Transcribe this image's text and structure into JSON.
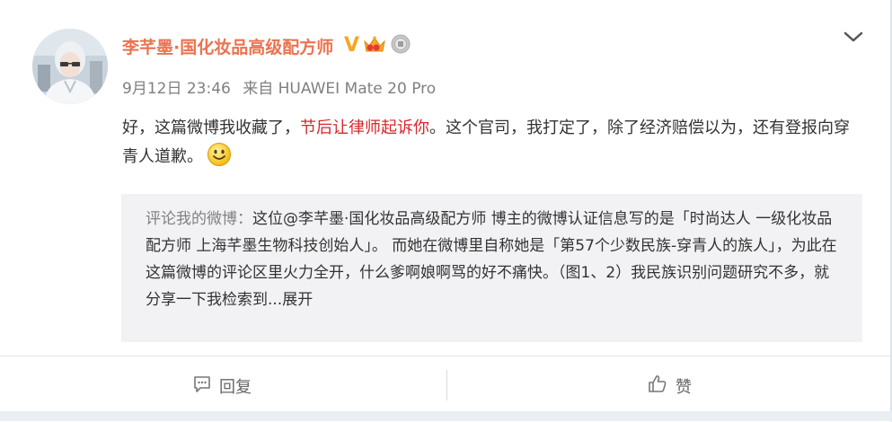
{
  "post": {
    "username": "李芊墨·国化妆品高级配方师",
    "badges": [
      "verified-v-icon",
      "vip-crown-icon",
      "medal-icon"
    ],
    "date": "9月12日 23:46",
    "source": "来自 HUAWEI Mate 20 Pro",
    "text_before": "好，这篇微博我收藏了，",
    "text_highlight": "节后让律师起诉你",
    "text_after": "。这个官司，我打定了，除了经济赔偿以为，还有登报向穿青人道歉。",
    "emoji": "smiley-icon"
  },
  "quote": {
    "source_label": "评论我的微博：",
    "text": "这位@李芊墨·国化妆品高级配方师  博主的微博认证信息写的是「时尚达人 一级化妆品配方师 上海芊墨生物科技创始人」。 而她在微博里自称她是「第57个少数民族-穿青人的族人」，为此在这篇微博的评论区里火力全开，什么爹啊娘啊骂的好不痛快。（图1、2）我民族识别问题研究不多，就分享一下我检索到...",
    "more_label": "展开"
  },
  "actions": {
    "reply_label": "回复",
    "like_label": "赞"
  },
  "colors": {
    "username": "#eb7350",
    "highlight": "#d9262b",
    "meta": "#808080",
    "quote_bg": "#f2f2f5"
  }
}
